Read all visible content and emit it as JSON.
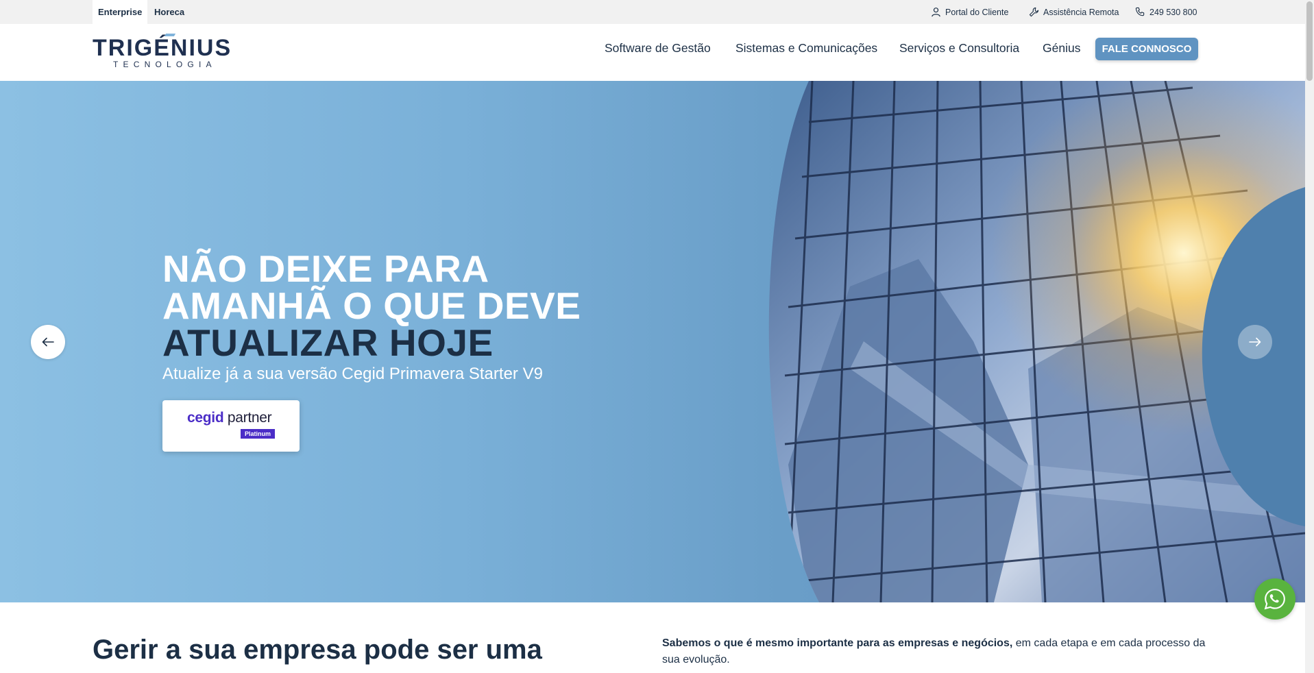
{
  "topbar": {
    "segments": [
      "Enterprise",
      "Horeca"
    ],
    "links": {
      "portal": "Portal do Cliente",
      "assist": "Assistência Remota",
      "phone": "249 530 800"
    }
  },
  "logo": {
    "main_before": "TRIG",
    "main_accent": "É",
    "main_after": "NIUS",
    "sub": "TECNOLOGIA"
  },
  "nav": {
    "items": [
      "Software de Gestão",
      "Sistemas e Comunicações",
      "Serviços e Consultoria",
      "Génius"
    ],
    "cta": "FALE CONNOSCO"
  },
  "hero": {
    "title_lines": [
      "NÃO DEIXE PARA",
      "AMANHÃ O QUE DEVE",
      "ATUALIZAR HOJE"
    ],
    "subtitle": "Atualize já a sua versão Cegid Primavera Starter V9",
    "badge": {
      "brand": "cegid",
      "word": "partner",
      "tag": "Platinum"
    }
  },
  "intro": {
    "title": "Gerir a sua empresa pode ser uma",
    "text_bold": "Sabemos o que é mesmo importante para as empresas e negócios,",
    "text_rest": " em cada etapa e em cada processo da sua evolução."
  },
  "colors": {
    "accent": "#5f93c1",
    "navy": "#1c2f45",
    "whatsapp": "#59b33e",
    "cegid": "#4b2dc7"
  }
}
